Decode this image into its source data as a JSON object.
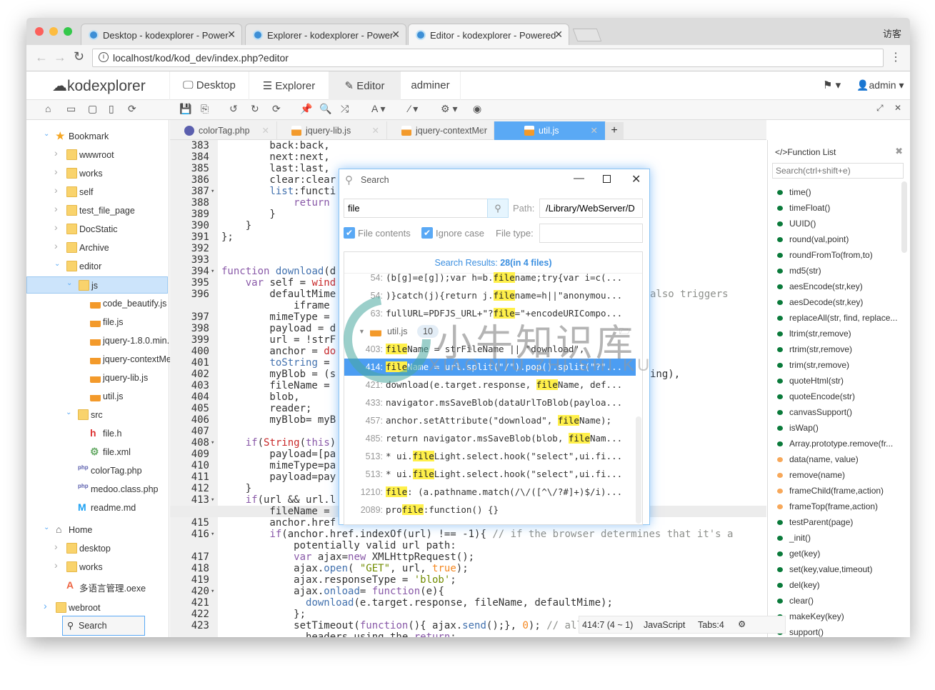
{
  "browser": {
    "tabs": [
      {
        "title": "Desktop - kodexplorer - Power"
      },
      {
        "title": "Explorer - kodexplorer - Power"
      },
      {
        "title": "Editor - kodexplorer - Powered"
      }
    ],
    "user": "访客",
    "url": "localhost/kod/kod_dev/index.php?editor"
  },
  "app": {
    "logo": "kodexplorer",
    "nav": [
      {
        "label": "Desktop"
      },
      {
        "label": "Explorer"
      },
      {
        "label": "Editor"
      },
      {
        "label": "adminer"
      }
    ],
    "user": "admin",
    "active_nav": "Editor"
  },
  "sidebar": {
    "items": [
      {
        "label": "Bookmark",
        "lvl": 0,
        "type": "star",
        "arrow": "open"
      },
      {
        "label": "wwwroot",
        "lvl": 1,
        "type": "folder",
        "arrow": "closed"
      },
      {
        "label": "works",
        "lvl": 1,
        "type": "folder",
        "arrow": "closed"
      },
      {
        "label": "self",
        "lvl": 1,
        "type": "folder",
        "arrow": "closed"
      },
      {
        "label": "test_file_page",
        "lvl": 1,
        "type": "folder",
        "arrow": "closed"
      },
      {
        "label": "DocStatic",
        "lvl": 1,
        "type": "folder",
        "arrow": "closed"
      },
      {
        "label": "Archive",
        "lvl": 1,
        "type": "folder",
        "arrow": "closed"
      },
      {
        "label": "editor",
        "lvl": 1,
        "type": "folder",
        "arrow": "open"
      },
      {
        "label": "js",
        "lvl": 2,
        "type": "folder",
        "arrow": "open",
        "selected": true
      },
      {
        "label": "code_beautify.js",
        "lvl": 3,
        "type": "js"
      },
      {
        "label": "file.js",
        "lvl": 3,
        "type": "js"
      },
      {
        "label": "jquery-1.8.0.min.",
        "lvl": 3,
        "type": "js"
      },
      {
        "label": "jquery-contextMe",
        "lvl": 3,
        "type": "js"
      },
      {
        "label": "jquery-lib.js",
        "lvl": 3,
        "type": "js"
      },
      {
        "label": "util.js",
        "lvl": 3,
        "type": "js"
      },
      {
        "label": "src",
        "lvl": 2,
        "type": "folder",
        "arrow": "open"
      },
      {
        "label": "file.h",
        "lvl": 3,
        "type": "h"
      },
      {
        "label": "file.xml",
        "lvl": 3,
        "type": "xml"
      },
      {
        "label": "colorTag.php",
        "lvl": 2,
        "type": "php"
      },
      {
        "label": "medoo.class.php",
        "lvl": 2,
        "type": "php"
      },
      {
        "label": "readme.md",
        "lvl": 2,
        "type": "md"
      },
      {
        "label": "Home",
        "lvl": 0,
        "type": "home",
        "arrow": "open",
        "gap": true
      },
      {
        "label": "desktop",
        "lvl": 1,
        "type": "folder",
        "arrow": "closed"
      },
      {
        "label": "works",
        "lvl": 1,
        "type": "folder",
        "arrow": "closed"
      },
      {
        "label": "多语言管理.oexe",
        "lvl": 1,
        "type": "oexe"
      },
      {
        "label": "webroot",
        "lvl": 0,
        "type": "folder",
        "arrow": "closed",
        "gap": true
      }
    ],
    "search_button": "Search"
  },
  "editor_tabs": [
    {
      "label": "colorTag.php"
    },
    {
      "label": "jquery-lib.js"
    },
    {
      "label": "jquery-contextMer"
    },
    {
      "label": "util.js",
      "active": true
    }
  ],
  "code": {
    "lines": [
      {
        "n": "383",
        "t": "        back:back,"
      },
      {
        "n": "384",
        "t": "        next:next,"
      },
      {
        "n": "385",
        "t": "        last:last,"
      },
      {
        "n": "386",
        "t": "        clear:clear"
      },
      {
        "n": "387",
        "t": "        list:functi",
        "fold": true
      },
      {
        "n": "388",
        "t": "            return"
      },
      {
        "n": "389",
        "t": "        }"
      },
      {
        "n": "390",
        "t": "    }"
      },
      {
        "n": "391",
        "t": "};"
      },
      {
        "n": "392",
        "t": ""
      },
      {
        "n": "393",
        "t": ""
      },
      {
        "n": "394",
        "t": "function download(d",
        "fold": true
      },
      {
        "n": "395",
        "t": "    var self = wind"
      },
      {
        "n": "396",
        "t": "        defaultMime",
        "right": "also triggers"
      },
      {
        "n": "",
        "t": "            iframe"
      },
      {
        "n": "397",
        "t": "        mimeType ="
      },
      {
        "n": "398",
        "t": "        payload = d"
      },
      {
        "n": "399",
        "t": "        url = !strF"
      },
      {
        "n": "400",
        "t": "        anchor = do"
      },
      {
        "n": "401",
        "t": "        toString ="
      },
      {
        "n": "402",
        "t": "        myBlob = (s",
        "right": "ing),"
      },
      {
        "n": "403",
        "t": "        fileName ="
      },
      {
        "n": "404",
        "t": "        blob,"
      },
      {
        "n": "405",
        "t": "        reader;"
      },
      {
        "n": "406",
        "t": "        myBlob= myB"
      },
      {
        "n": "407",
        "t": ""
      },
      {
        "n": "408",
        "t": "    if(String(this)",
        "fold": true
      },
      {
        "n": "409",
        "t": "        payload=[pa"
      },
      {
        "n": "410",
        "t": "        mimeType=pa"
      },
      {
        "n": "411",
        "t": "        payload=pay"
      },
      {
        "n": "412",
        "t": "    }"
      },
      {
        "n": "413",
        "t": "    if(url && url.l",
        "fold": true
      },
      {
        "n": "414",
        "t": "        fileName =",
        "current": true
      },
      {
        "n": "415",
        "t": "        anchor.href"
      },
      {
        "n": "416",
        "t": "        if(anchor.href.indexOf(url) !== -1){ // if the browser determines that it's a",
        "fold": true
      },
      {
        "n": "",
        "t": "            potentially valid url path:"
      },
      {
        "n": "417",
        "t": "            var ajax=new XMLHttpRequest();"
      },
      {
        "n": "418",
        "t": "            ajax.open( \"GET\", url, true);"
      },
      {
        "n": "419",
        "t": "            ajax.responseType = 'blob';"
      },
      {
        "n": "420",
        "t": "            ajax.onload= function(e){",
        "fold": true
      },
      {
        "n": "421",
        "t": "              download(e.target.response, fileName, defaultMime);"
      },
      {
        "n": "422",
        "t": "            };"
      },
      {
        "n": "423",
        "t": "            setTimeout(function(){ ajax.send();}, 0); // allows setting custom ajax"
      },
      {
        "n": "",
        "t": "              headers using the return:"
      }
    ]
  },
  "status": {
    "position": "414:7 (4 ~ 1)",
    "mode": "JavaScript",
    "tabs": "Tabs:4"
  },
  "function_list": {
    "title": "</>Function List",
    "search_placeholder": "Search(ctrl+shift+e)",
    "items": [
      {
        "name": "time()",
        "c": "#0a7a3a"
      },
      {
        "name": "timeFloat()",
        "c": "#0a7a3a"
      },
      {
        "name": "UUID()",
        "c": "#0a7a3a"
      },
      {
        "name": "round(val,point)",
        "c": "#0a7a3a"
      },
      {
        "name": "roundFromTo(from,to)",
        "c": "#0a7a3a"
      },
      {
        "name": "md5(str)",
        "c": "#0a7a3a"
      },
      {
        "name": "aesEncode(str,key)",
        "c": "#0a7a3a"
      },
      {
        "name": "aesDecode(str,key)",
        "c": "#0a7a3a"
      },
      {
        "name": "replaceAll(str, find, replace...",
        "c": "#0a7a3a"
      },
      {
        "name": "ltrim(str,remove)",
        "c": "#0a7a3a"
      },
      {
        "name": "rtrim(str,remove)",
        "c": "#0a7a3a"
      },
      {
        "name": "trim(str,remove)",
        "c": "#0a7a3a"
      },
      {
        "name": "quoteHtml(str)",
        "c": "#0a7a3a"
      },
      {
        "name": "quoteEncode(str)",
        "c": "#0a7a3a"
      },
      {
        "name": "canvasSupport()",
        "c": "#0a7a3a"
      },
      {
        "name": "isWap()",
        "c": "#0a7a3a"
      },
      {
        "name": "Array.prototype.remove(fr...",
        "c": "#0a7a3a"
      },
      {
        "name": "data(name, value)",
        "c": "#f7a85a"
      },
      {
        "name": "remove(name)",
        "c": "#f7a85a"
      },
      {
        "name": "frameChild(frame,action)",
        "c": "#f7a85a"
      },
      {
        "name": "frameTop(frame,action)",
        "c": "#f7a85a"
      },
      {
        "name": "testParent(page)",
        "c": "#0a7a3a"
      },
      {
        "name": "_init()",
        "c": "#0a7a3a"
      },
      {
        "name": "get(key)",
        "c": "#0a7a3a"
      },
      {
        "name": "set(key,value,timeout)",
        "c": "#0a7a3a"
      },
      {
        "name": "del(key)",
        "c": "#0a7a3a"
      },
      {
        "name": "clear()",
        "c": "#0a7a3a"
      },
      {
        "name": "makeKey(key)",
        "c": "#0a7a3a"
      },
      {
        "name": "support()",
        "c": "#0a7a3a"
      }
    ]
  },
  "search_dialog": {
    "title": "Search",
    "query": "file",
    "path_label": "Path:",
    "path": "/Library/WebServer/D",
    "file_contents": "File contents",
    "ignore_case": "Ignore case",
    "file_type_label": "File type:",
    "file_type": "",
    "results_label": "Search Results: ",
    "results_count": "28(in 4 files)",
    "results": [
      {
        "n": "54:",
        "pre": "(b[g]=e[g]);var h=b.",
        "hl": "file",
        "post": "name;try{var i=c(..."
      },
      {
        "n": "54:",
        "pre": ")}catch(j){return j.",
        "hl": "file",
        "post": "name=h||\"anonymou..."
      },
      {
        "n": "63:",
        "pre": "fullURL=PDFJS_URL+\"?",
        "hl": "file",
        "post": "=\"+encodeURICompo..."
      },
      {
        "group": "util.js",
        "count": "10"
      },
      {
        "n": "403:",
        "pre": "",
        "hl": "file",
        "post": "Name = strFileName || \"download\","
      },
      {
        "n": "414:",
        "pre": "",
        "hl": "file",
        "post": "Name = url.split(\"/\").pop().split(\"?\"...",
        "selected": true
      },
      {
        "n": "421:",
        "pre": "download(e.target.response, ",
        "hl": "file",
        "post": "Name, def..."
      },
      {
        "n": "433:",
        "pre": "navigator.msSaveBlob(dataUrlToBlob(payloa...",
        "hl": "",
        "post": ""
      },
      {
        "n": "457:",
        "pre": "anchor.setAttribute(\"download\", ",
        "hl": "file",
        "post": "Name);"
      },
      {
        "n": "485:",
        "pre": "return navigator.msSaveBlob(blob, ",
        "hl": "file",
        "post": "Nam..."
      },
      {
        "n": "513:",
        "pre": "* ui.",
        "hl": "file",
        "post": "Light.select.hook(\"select\",ui.fi..."
      },
      {
        "n": "513:",
        "pre": "* ui.",
        "hl": "file",
        "post": "Light.select.hook(\"select\",ui.fi..."
      },
      {
        "n": "1210:",
        "pre": "",
        "hl": "file",
        "post": ": (a.pathname.match(/\\/([^\\/?#]+)$/i)..."
      },
      {
        "n": "2089:",
        "pre": "pro",
        "hl": "file",
        "post": ":function() {}"
      }
    ]
  },
  "watermark": {
    "cn": "小牛知识库",
    "en": "XIAO NIU ZHI SHI KU"
  },
  "colors": {
    "accent": "#5aa9f5",
    "highlight": "#fff04a",
    "selection": "#4c9df2"
  }
}
